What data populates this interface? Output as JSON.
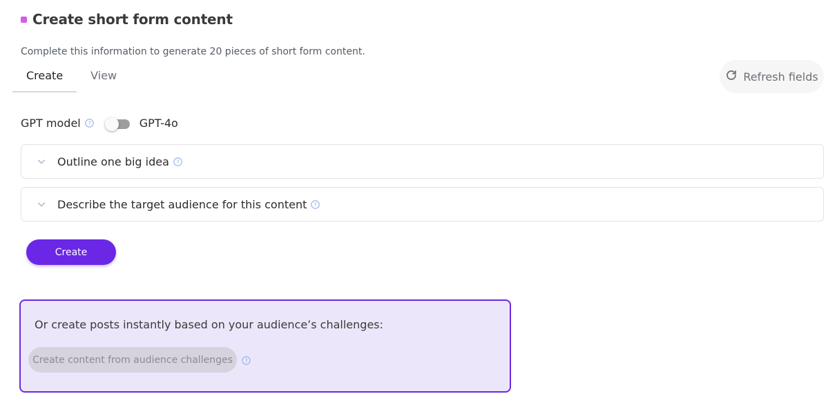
{
  "colors": {
    "accent": "#6a28e6",
    "title_marker": "#d85ae8",
    "help_icon": "#8fb0e6",
    "challenge_border": "#6a28e6",
    "challenge_bg": "#ece6fa",
    "disabled_button_bg": "#d6d2de"
  },
  "header": {
    "title": "Create short form content",
    "subtitle": "Complete this information to generate 20 pieces of short form content."
  },
  "tabs": [
    {
      "label": "Create",
      "active": true
    },
    {
      "label": "View",
      "active": false
    }
  ],
  "refresh": {
    "label": "Refresh fields",
    "icon": "refresh-icon"
  },
  "gpt": {
    "label": "GPT model",
    "toggle_on": false,
    "value": "GPT-4o"
  },
  "accordions": [
    {
      "label": "Outline one big idea",
      "expanded": false
    },
    {
      "label": "Describe the target audience for this content",
      "expanded": false
    }
  ],
  "create_button": {
    "label": "Create"
  },
  "challenges": {
    "text": "Or create posts instantly based on your audience’s challenges:",
    "button_label": "Create content from audience challenges",
    "button_disabled": true
  }
}
